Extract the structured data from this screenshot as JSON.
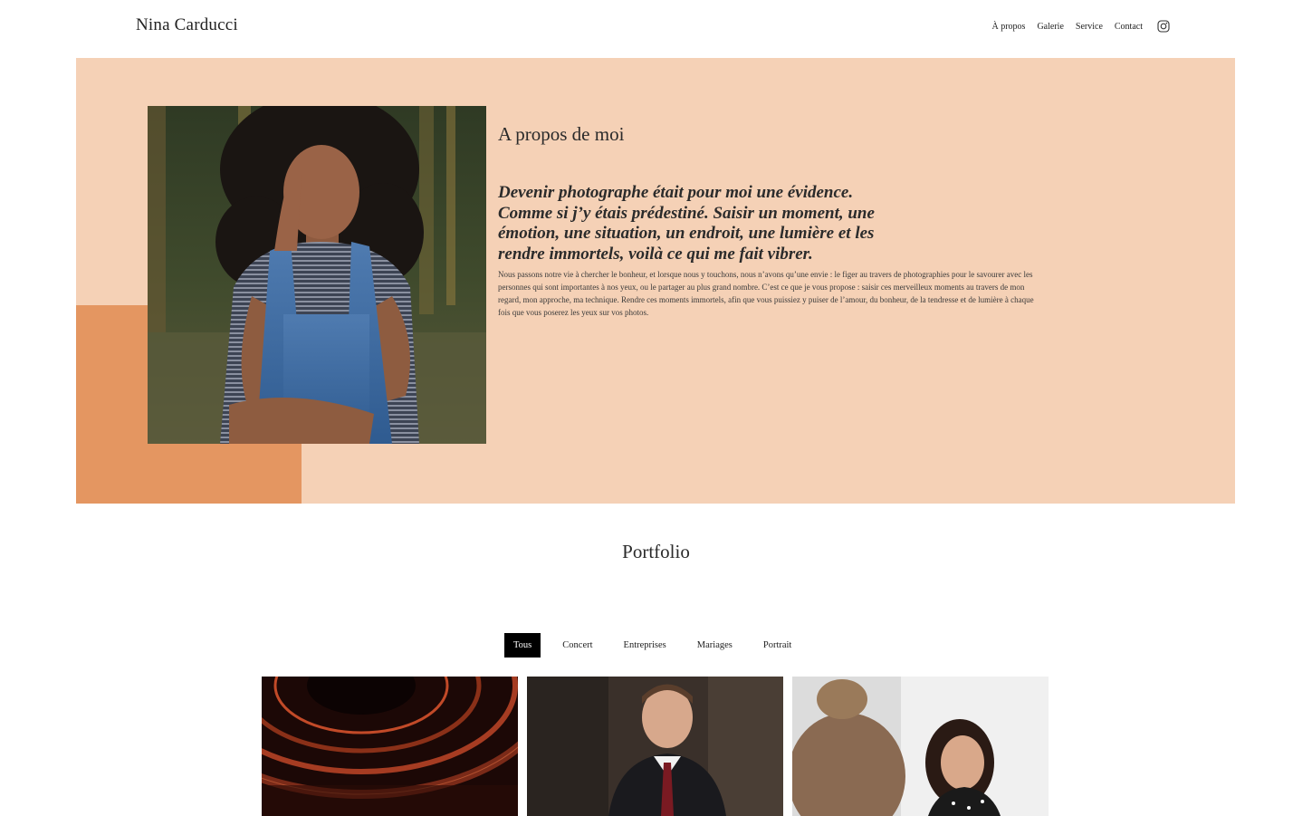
{
  "header": {
    "brand": "Nina Carducci",
    "nav": [
      {
        "label": "À propos"
      },
      {
        "label": "Galerie"
      },
      {
        "label": "Service"
      },
      {
        "label": "Contact"
      }
    ],
    "social_icon": "instagram-icon"
  },
  "about": {
    "title": "A propos de moi",
    "quote": "Devenir photographe était pour moi une évidence. Comme si j’y étais prédestiné. Saisir un moment, une émotion, une situation, un endroit, une lumière et les rendre immortels, voilà ce qui me fait vibrer.",
    "body": "Nous passons notre vie à chercher le bonheur, et lorsque nous y touchons, nous n’avons qu’une envie : le figer au travers de photographies pour le savourer avec les personnes qui sont importantes à nos yeux, ou le partager au plus grand nombre. C’est ce que je vous propose : saisir ces merveilleux moments au travers de mon regard, mon approche, ma technique. Rendre ces moments immortels, afin que vous puissiez y puiser de l’amour, du bonheur, de la tendresse et de lumière à chaque fois que vous poserez les yeux sur vos photos."
  },
  "portfolio": {
    "title": "Portfolio",
    "filters": [
      {
        "label": "Tous",
        "active": true
      },
      {
        "label": "Concert",
        "active": false
      },
      {
        "label": "Entreprises",
        "active": false
      },
      {
        "label": "Mariages",
        "active": false
      },
      {
        "label": "Portrait",
        "active": false
      }
    ]
  },
  "colors": {
    "about_bg": "#f5d1b6",
    "accent": "#e49661",
    "active_filter_bg": "#000000",
    "text": "#1f1f1f"
  }
}
